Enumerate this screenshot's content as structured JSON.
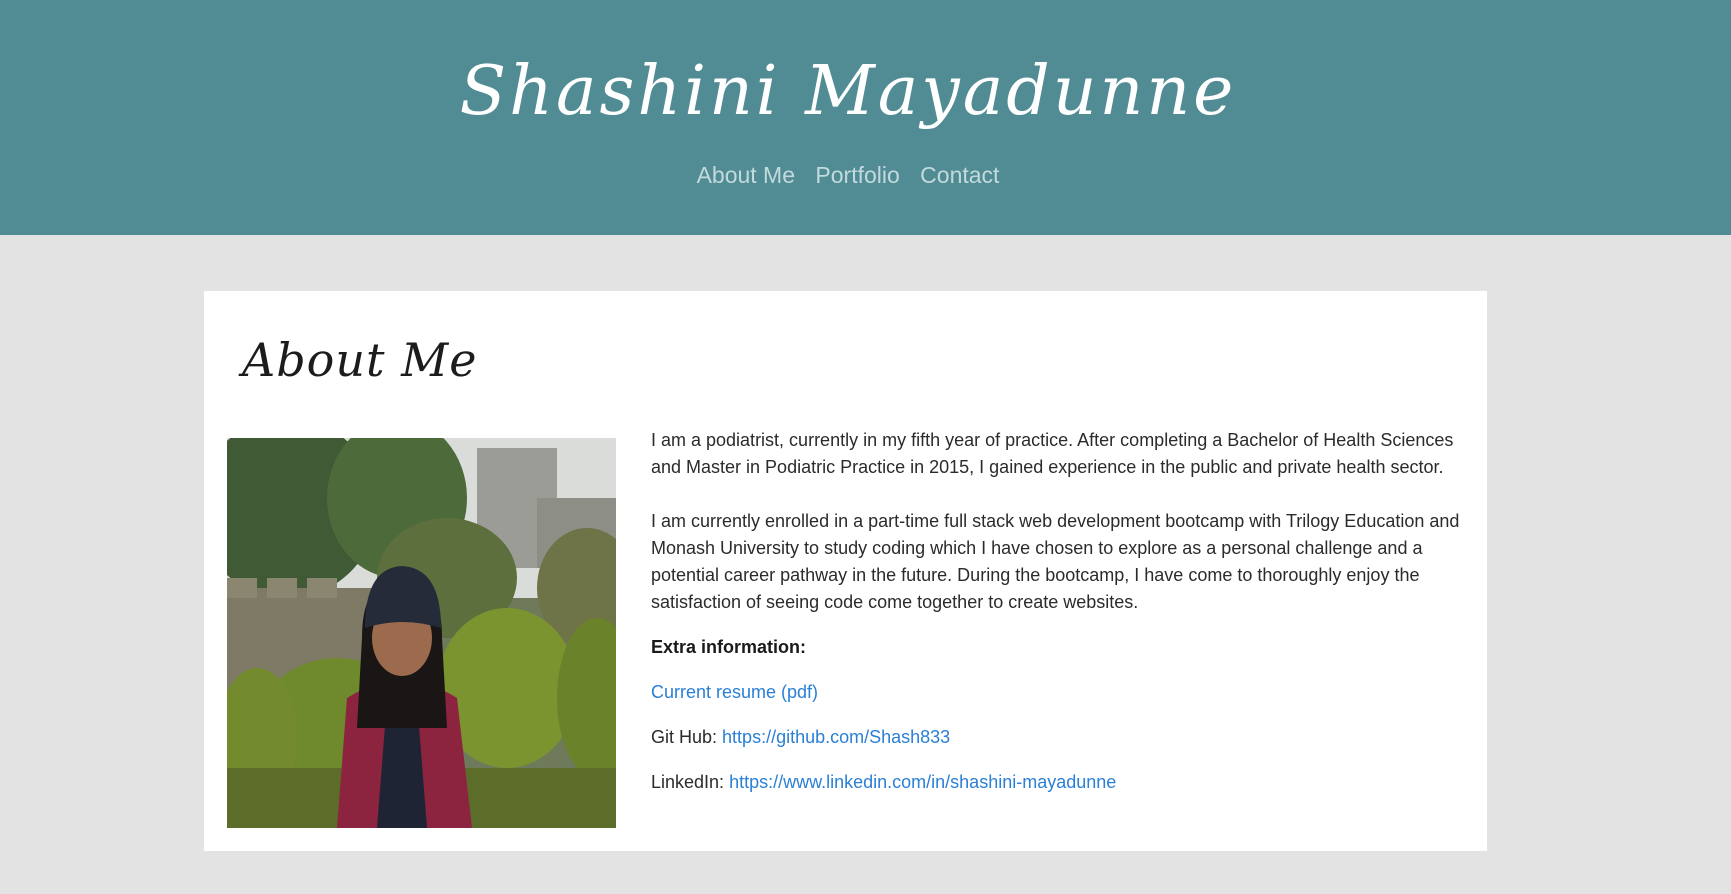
{
  "header": {
    "title": "Shashini Mayadunne",
    "nav": [
      "About Me",
      "Portfolio",
      "Contact"
    ]
  },
  "about": {
    "heading": "About Me",
    "paragraph1": "I am a podiatrist, currently in my fifth year of practice. After completing a Bachelor of Health Sciences and Master in Podiatric Practice in 2015, I gained experience in the public and private health sector.",
    "paragraph2": "I am currently enrolled in a part-time full stack web development bootcamp with Trilogy Education and Monash University to study coding which I have chosen to explore as a personal challenge and a potential career pathway in the future. During the bootcamp, I have come to thoroughly enjoy the satisfaction of seeing code come together to create websites.",
    "extra_label": "Extra information:",
    "resume_link": "Current resume (pdf)",
    "github_label": "Git Hub:",
    "github_link": "https://github.com/Shash833",
    "linkedin_label": "LinkedIn:",
    "linkedin_link": "https://www.linkedin.com/in/shashini-mayadunne"
  },
  "colors": {
    "header_bg": "#518c94",
    "page_bg": "#e3e3e3",
    "link": "#2a7fd6",
    "nav_link": "#c2dadd"
  }
}
